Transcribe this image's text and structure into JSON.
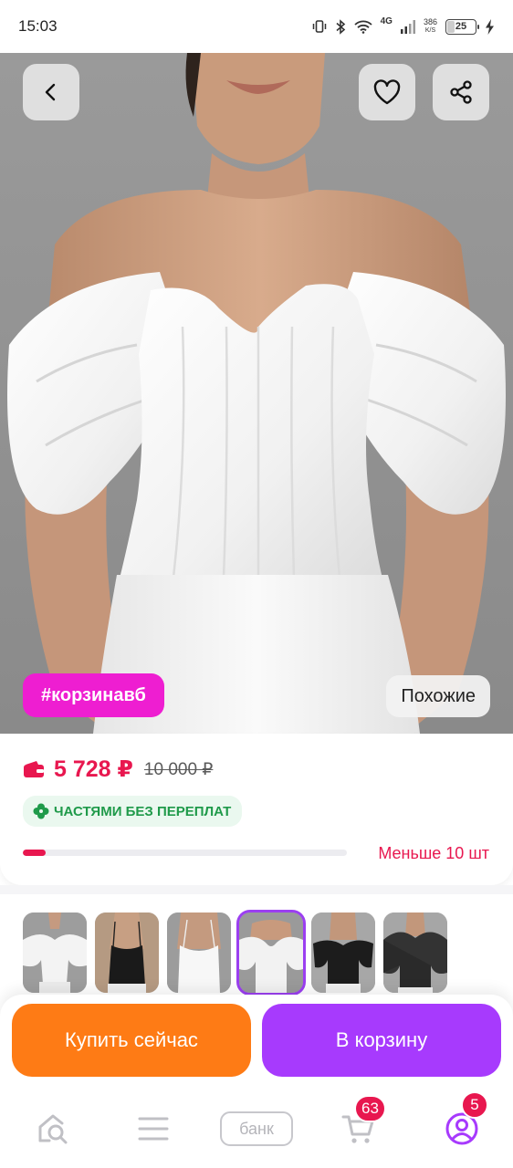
{
  "status_bar": {
    "time": "15:03",
    "network": "4G",
    "speed_value": "386",
    "speed_unit": "K/S",
    "battery": "25",
    "icons": [
      "vibrate-icon",
      "bluetooth-icon",
      "wifi-icon",
      "signal-icon",
      "battery-icon",
      "charging-icon"
    ]
  },
  "hero": {
    "hashtag": "#корзинавб",
    "similar_label": "Похожие",
    "buttons": [
      "back-icon",
      "heart-icon",
      "share-icon"
    ]
  },
  "price": {
    "current": "5 728 ₽",
    "old": "10 000 ₽",
    "installments": "ЧАСТЯМИ БЕЗ ПЕРЕПЛАТ",
    "stock_label": "Меньше 10 шт",
    "stock_level": 0.07,
    "accent_color": "#e8174f"
  },
  "gallery": {
    "selected_index": 3,
    "thumbs": [
      "white-puff-sleeve-top",
      "black-cami-top",
      "white-cami-top",
      "white-off-shoulder-top",
      "black-off-shoulder-top",
      "black-sheer-sleeve-top"
    ]
  },
  "actions": {
    "buy_now": "Купить сейчас",
    "add_to_cart": "В корзину",
    "buy_color": "#fe7b15",
    "cart_color": "#a73afd"
  },
  "bottom_nav": {
    "bank_label": "банк",
    "cart_badge": "63",
    "profile_badge": "5",
    "items": [
      "home-icon",
      "catalog-icon",
      "bank",
      "cart-icon",
      "profile-icon"
    ]
  }
}
